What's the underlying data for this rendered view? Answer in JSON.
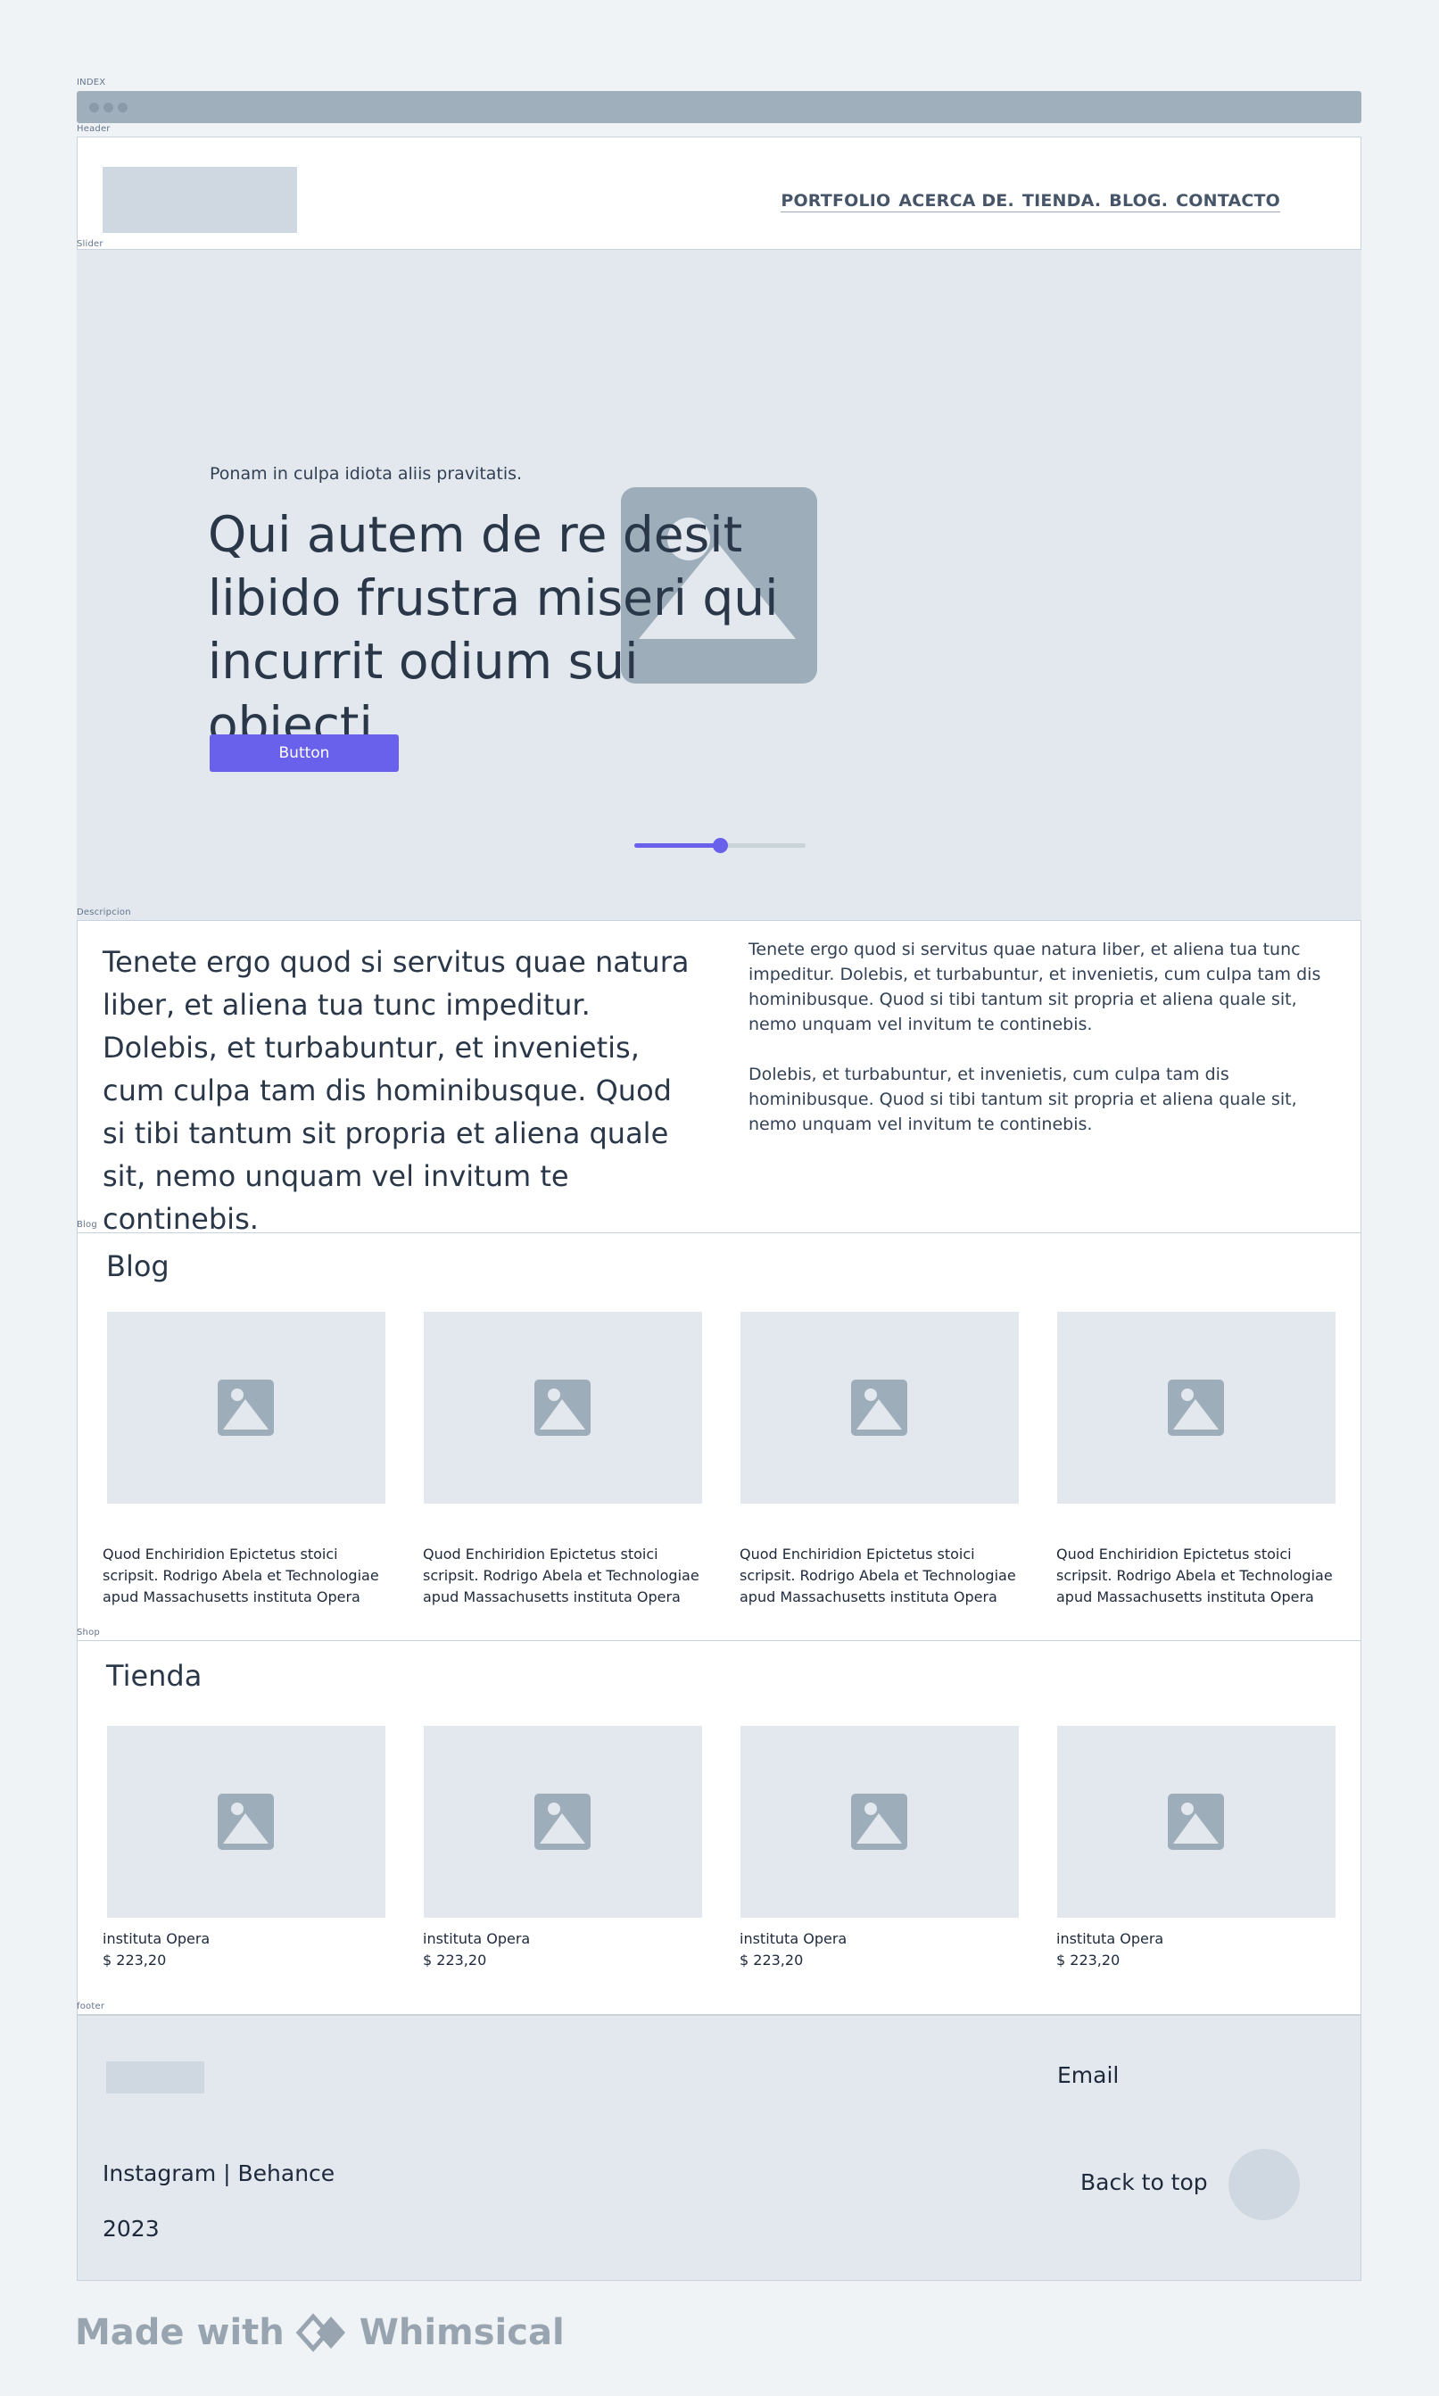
{
  "frames": {
    "index": "INDEX",
    "header": "Header",
    "slider": "Slider",
    "description": "Descripcion",
    "blog": "Blog",
    "shop": "Shop",
    "footer": "footer"
  },
  "header": {
    "nav": [
      "PORTFOLIO",
      "ACERCA DE.",
      "TIENDA.",
      "BLOG.",
      "CONTACTO"
    ]
  },
  "slider": {
    "eyebrow": "Ponam in culpa idiota aliis pravitatis.",
    "title": "Qui autem de re desit libido frustra miseri qui incurrit odium sui obiecti.",
    "button_label": "Button",
    "progress": 0.5,
    "accent": "#6960ec"
  },
  "description": {
    "lead": "Tenete ergo quod si servitus quae natura liber, et aliena tua tunc impeditur. Dolebis, et turbabuntur, et invenietis, cum culpa tam dis hominibusque. Quod si tibi tantum sit propria et aliena quale sit, nemo unquam vel invitum te continebis.",
    "paragraph_1": "Tenete ergo quod si servitus quae natura liber, et aliena tua tunc impeditur. Dolebis, et turbabuntur, et invenietis, cum culpa tam dis hominibusque. Quod si tibi tantum sit propria et aliena quale sit, nemo unquam vel invitum te continebis.",
    "paragraph_2": "Dolebis, et turbabuntur, et invenietis, cum culpa tam dis hominibusque. Quod si tibi tantum sit propria et aliena quale sit, nemo unquam vel invitum te continebis."
  },
  "blog": {
    "title": "Blog",
    "posts": [
      {
        "excerpt": "Quod Enchiridion Epictetus stoici scripsit. Rodrigo Abela et Technologiae apud Massachusetts instituta Opera"
      },
      {
        "excerpt": "Quod Enchiridion Epictetus stoici scripsit. Rodrigo Abela et Technologiae apud Massachusetts instituta Opera"
      },
      {
        "excerpt": "Quod Enchiridion Epictetus stoici scripsit. Rodrigo Abela et Technologiae apud Massachusetts instituta Opera"
      },
      {
        "excerpt": "Quod Enchiridion Epictetus stoici scripsit. Rodrigo Abela et Technologiae apud Massachusetts instituta Opera"
      }
    ]
  },
  "shop": {
    "title": "Tienda",
    "products": [
      {
        "name": "instituta Opera",
        "price": "$ 223,20"
      },
      {
        "name": "instituta Opera",
        "price": "$ 223,20"
      },
      {
        "name": "instituta Opera",
        "price": "$ 223,20"
      },
      {
        "name": "instituta Opera",
        "price": "$ 223,20"
      }
    ]
  },
  "footer": {
    "email_label": "Email",
    "social": "Instagram | Behance",
    "year": "2023",
    "back_to_top": "Back to top"
  },
  "branding": {
    "made_with": "Made with",
    "brand": "Whimsical"
  },
  "icons": {
    "placeholder": "image-placeholder-icon",
    "brand": "whimsical-logo-icon"
  }
}
